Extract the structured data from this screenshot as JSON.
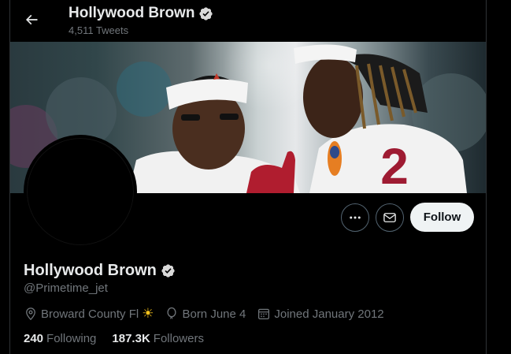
{
  "header": {
    "name": "Hollywood Brown",
    "tweet_count": "4,511 Tweets"
  },
  "actions": {
    "more_label": "•••",
    "follow_label": "Follow"
  },
  "profile": {
    "name": "Hollywood Brown",
    "handle": "@Primetime_jet",
    "location": "Broward County Fl",
    "location_emoji": "☀",
    "birthday": "Born June 4",
    "joined": "Joined January 2012",
    "following_count": "240",
    "following_label": "Following",
    "followers_count": "187.3K",
    "followers_label": "Followers"
  },
  "banner": {
    "jersey_number": "2"
  },
  "colors": {
    "background": "#000000",
    "verified": "#d9d9d9",
    "follow_bg": "#eff3f4",
    "secondary_text": "#71767b",
    "sun": "#f7c31d",
    "jersey_red": "#9e1b32"
  },
  "icons": {
    "back": "arrow-left-icon",
    "verified": "verified-badge-icon",
    "more": "more-horizontal-icon",
    "message": "envelope-icon",
    "location": "location-pin-icon",
    "birthday": "balloon-icon",
    "joined": "calendar-icon"
  }
}
